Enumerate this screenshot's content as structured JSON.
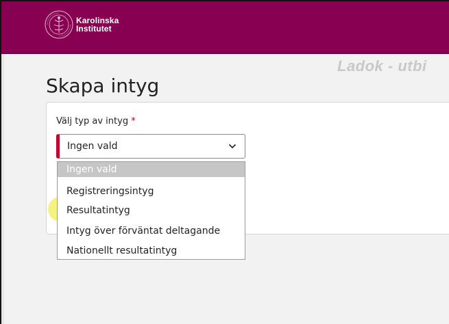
{
  "header": {
    "brand_line1": "Karolinska",
    "brand_line2": "Institutet",
    "brand_color": "#870052"
  },
  "app_title": "Ladok - utbi",
  "page_title": "Skapa intyg",
  "form": {
    "label": "Välj typ av intyg",
    "required_marker": "*",
    "select_value": "Ingen vald",
    "options": [
      "Ingen vald",
      "Registreringsintyg",
      "Resultatintyg",
      "Intyg över förväntat deltagande",
      "Nationellt resultatintyg"
    ],
    "highlighted_option": "Resultatintyg"
  },
  "icons": {
    "logo": "karolinska-seal-icon",
    "select_arrow": "chevron-down-icon"
  },
  "colors": {
    "required": "#c2002f",
    "selected_option_bg": "#c6c6c6",
    "highlight": "#f5f06a"
  }
}
